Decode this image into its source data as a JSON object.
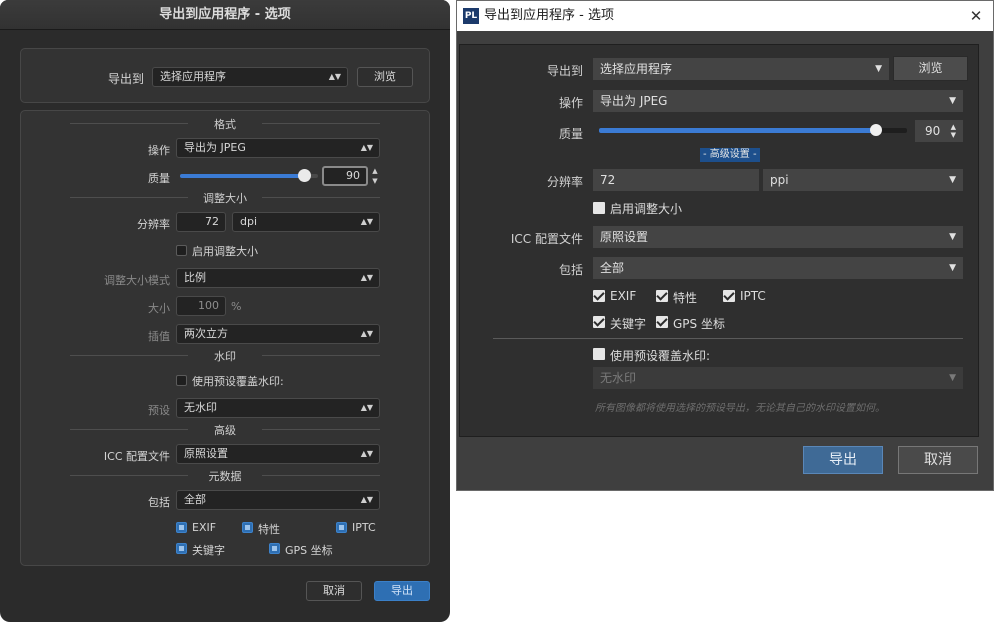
{
  "left_dialog": {
    "title": "导出到应用程序 - 选项",
    "export_to_label": "导出到",
    "export_to_value": "选择应用程序",
    "browse_label": "浏览",
    "sections": {
      "format": "格式",
      "resize": "调整大小",
      "watermark": "水印",
      "advanced": "高级",
      "metadata": "元数据"
    },
    "operation_label": "操作",
    "operation_value": "导出为 JPEG",
    "quality_label": "质量",
    "quality_value": "90",
    "quality_fraction": 0.9,
    "resolution_label": "分辨率",
    "resolution_value": "72",
    "resolution_unit": "dpi",
    "enable_resize_label": "启用调整大小",
    "resize_mode_label": "调整大小模式",
    "resize_mode_value": "比例",
    "size_label": "大小",
    "size_value": "100",
    "size_unit": "%",
    "interpolation_label": "插值",
    "interpolation_value": "两次立方",
    "use_preset_watermark_label": "使用预设覆盖水印:",
    "preset_label": "预设",
    "preset_value": "无水印",
    "icc_label": "ICC 配置文件",
    "icc_value": "原照设置",
    "include_label": "包括",
    "include_value": "全部",
    "meta_exif": "EXIF",
    "meta_properties": "特性",
    "meta_iptc": "IPTC",
    "meta_keywords": "关键字",
    "meta_gps": "GPS 坐标",
    "cancel_label": "取消",
    "export_label": "导出"
  },
  "right_dialog": {
    "app_icon_text": "PL",
    "title": "导出到应用程序 - 选项",
    "close_glyph": "✕",
    "export_to_label": "导出到",
    "export_to_value": "选择应用程序",
    "browse_label": "浏览",
    "operation_label": "操作",
    "operation_value": "导出为 JPEG",
    "quality_label": "质量",
    "quality_value": "90",
    "quality_fraction": 0.9,
    "advanced_label": "- 高级设置 -",
    "resolution_label": "分辨率",
    "resolution_value": "72",
    "resolution_unit": "ppi",
    "enable_resize_label": "启用调整大小",
    "icc_label": "ICC 配置文件",
    "icc_value": "原照设置",
    "include_label": "包括",
    "include_value": "全部",
    "meta_exif": "EXIF",
    "meta_properties": "特性",
    "meta_iptc": "IPTC",
    "meta_keywords": "关键字",
    "meta_gps": "GPS 坐标",
    "use_preset_watermark_label": "使用预设覆盖水印:",
    "watermark_value": "无水印",
    "watermark_note": "所有图像都将使用选择的预设导出，无论其自己的水印设置如何。",
    "export_label": "导出",
    "cancel_label": "取消"
  },
  "colors": {
    "accent": "#2e6fb3",
    "slider_fill": "#3b7bd4",
    "dark_bg": "#2b2b2b"
  }
}
